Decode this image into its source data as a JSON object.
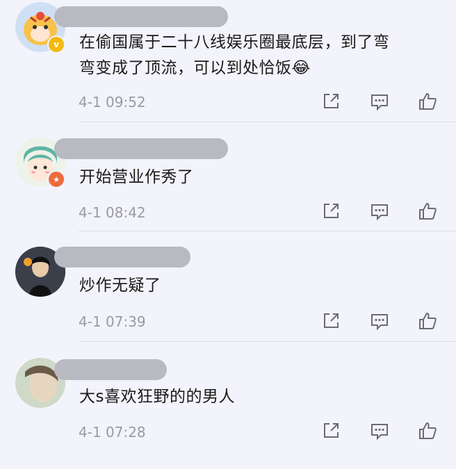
{
  "comments": [
    {
      "text_line1": "在偷国属于二十八线娱乐圈最底层，到了弯",
      "text_line2": "弯变成了顶流，可以到处恰饭😂",
      "time": "4-1 09:52",
      "badge_symbol": "v",
      "badge_color": "#f2b90f"
    },
    {
      "text_line1": "开始营业作秀了",
      "time": "4-1 08:42",
      "badge_symbol": "★",
      "badge_color": "#ef6a3c"
    },
    {
      "text_line1": "炒作无疑了",
      "time": "4-1 07:39"
    },
    {
      "text_line1": "大s喜欢狂野的的男人",
      "time": "4-1 07:28"
    }
  ],
  "icons": {
    "share": "share-icon",
    "comment": "comment-icon",
    "like": "thumbs-up-icon"
  }
}
